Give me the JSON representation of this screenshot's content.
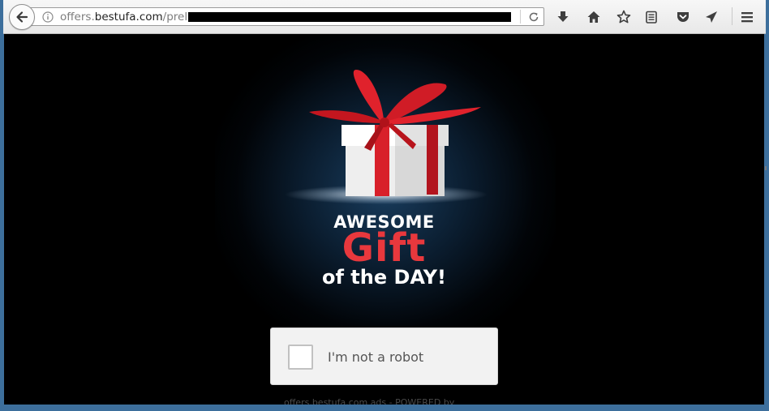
{
  "browser": {
    "url_prefix": "offers.",
    "url_domain": "bestufa.com",
    "url_path": "/prela"
  },
  "offer": {
    "line1": "AWESOME",
    "line2": "Gift",
    "line3": "of the DAY!"
  },
  "captcha": {
    "label": "I'm not a robot",
    "checked": false
  },
  "footer": {
    "text": "offers.bestufa.com ads - POWERED by"
  },
  "colors": {
    "accent_red": "#e8383d",
    "page_background": "#000000",
    "glow": "#1a4063"
  }
}
